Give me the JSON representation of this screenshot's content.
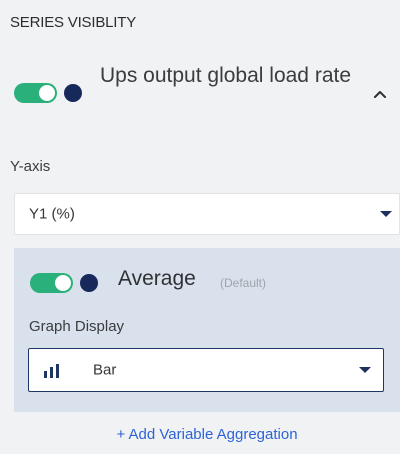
{
  "header": {
    "title": "SERIES VISIBLITY"
  },
  "series": {
    "name": "Ups output global load rate",
    "toggle_on": true,
    "color": "#17285a",
    "expand_icon": "chevron-up-icon"
  },
  "yaxis": {
    "label": "Y-axis",
    "selected": "Y1 (%)"
  },
  "aggregation": {
    "name": "Average",
    "default_tag": "(Default)",
    "toggle_on": true,
    "graph_display_label": "Graph Display",
    "graph_display_value": "Bar",
    "graph_icon": "bar-chart-icon"
  },
  "add_aggregation": "+ Add Variable Aggregation",
  "colors": {
    "accent_green": "#29b07b",
    "navy": "#17285a",
    "link_blue": "#2e63d8",
    "panel": "#d9e1ec"
  }
}
